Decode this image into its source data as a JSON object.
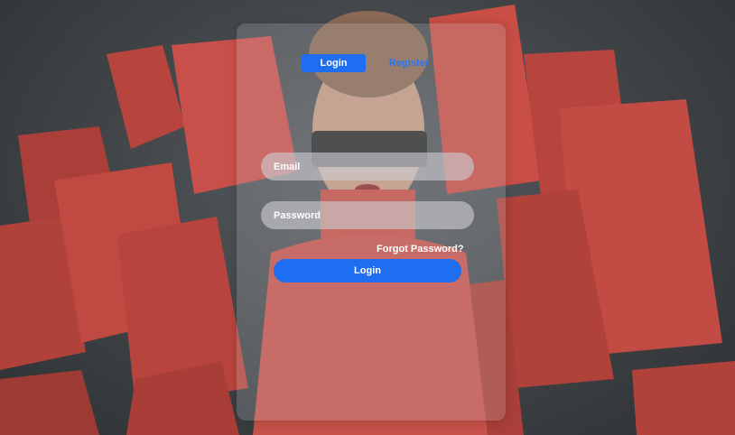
{
  "auth": {
    "tabs": [
      {
        "label": "Login",
        "active": true
      },
      {
        "label": "Register",
        "active": false
      }
    ],
    "email": {
      "placeholder": "Email",
      "value": ""
    },
    "password": {
      "placeholder": "Password",
      "value": ""
    },
    "forgot_label": "Forgot Password?",
    "submit_label": "Login"
  },
  "colors": {
    "accent": "#1f6df1",
    "background": "#3f4346",
    "bag_red": "#c4483f"
  }
}
